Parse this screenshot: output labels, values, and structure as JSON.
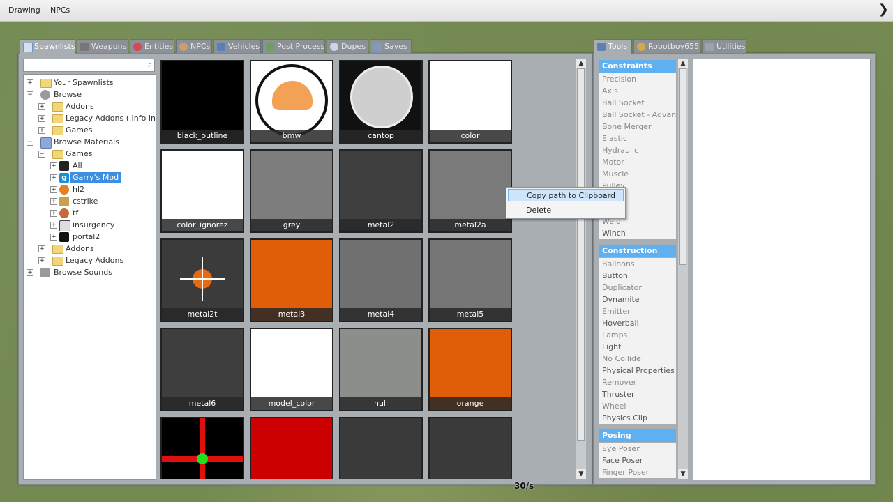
{
  "topbar": {
    "menu": [
      "Drawing",
      "NPCs"
    ]
  },
  "spawnmenu": {
    "tabs": [
      "Spawnlists",
      "Weapons",
      "Entities",
      "NPCs",
      "Vehicles",
      "Post Process",
      "Dupes",
      "Saves"
    ],
    "active_tab": "Spawnlists",
    "search": {
      "value": "",
      "placeholder": ""
    },
    "tree": [
      {
        "label": "Your Spawnlists",
        "expander": "+"
      },
      {
        "label": "Browse",
        "expander": "−"
      },
      {
        "label": "Addons",
        "expander": "+"
      },
      {
        "label": "Legacy Addons ( Info In...",
        "expander": "+"
      },
      {
        "label": "Games",
        "expander": "+"
      },
      {
        "label": "Browse Materials",
        "expander": "−"
      },
      {
        "label": "Games",
        "expander": "−"
      },
      {
        "label": "All",
        "expander": "+"
      },
      {
        "label": "Garry's Mod",
        "expander": "+",
        "selected": true
      },
      {
        "label": "hl2",
        "expander": "+"
      },
      {
        "label": "cstrike",
        "expander": "+"
      },
      {
        "label": "tf",
        "expander": "+"
      },
      {
        "label": "insurgency",
        "expander": "+"
      },
      {
        "label": "portal2",
        "expander": "+"
      },
      {
        "label": "Addons",
        "expander": "+"
      },
      {
        "label": "Legacy Addons",
        "expander": "+"
      },
      {
        "label": "Browse Sounds",
        "expander": "+"
      }
    ],
    "materials": [
      {
        "name": "black_outline",
        "color": "#000000"
      },
      {
        "name": "bmw",
        "color": "#ffffff"
      },
      {
        "name": "cantop",
        "color": "#111111"
      },
      {
        "name": "color",
        "color": "#ffffff"
      },
      {
        "name": "color_ignorez",
        "color": "#ffffff"
      },
      {
        "name": "grey",
        "color": "#7d7d7d"
      },
      {
        "name": "metal2",
        "color": "#3f3f3f"
      },
      {
        "name": "metal2a",
        "color": "#7a7a7a"
      },
      {
        "name": "metal2t",
        "color": "#3b3b3b"
      },
      {
        "name": "metal3",
        "color": "#e05d0a"
      },
      {
        "name": "metal4",
        "color": "#707070"
      },
      {
        "name": "metal5",
        "color": "#767676"
      },
      {
        "name": "metal6",
        "color": "#3e3e3e"
      },
      {
        "name": "model_color",
        "color": "#ffffff"
      },
      {
        "name": "null",
        "color": "#8b8e8a"
      },
      {
        "name": "orange",
        "color": "#e05d0a"
      },
      {
        "name": "",
        "color": "#000000"
      },
      {
        "name": "",
        "color": "#cc0000"
      },
      {
        "name": "",
        "color": "#3a3a3a"
      },
      {
        "name": "",
        "color": "#3a3a3a"
      }
    ],
    "context_menu": [
      "Copy path to Clipboard",
      "Delete"
    ]
  },
  "toolmenu": {
    "tabs": [
      "Tools",
      "Robotboy655",
      "Utilities"
    ],
    "active_tab": "Tools",
    "categories": [
      {
        "title": "Constraints",
        "items": [
          "Precision",
          "Axis",
          "Ball Socket",
          "Ball Socket - Advan...",
          "Bone Merger",
          "Elastic",
          "Hydraulic",
          "Motor",
          "Muscle",
          "Pulley",
          "Rope",
          "Slider",
          "Weld",
          "Winch"
        ]
      },
      {
        "title": "Construction",
        "items": [
          "Balloons",
          "Button",
          "Duplicator",
          "Dynamite",
          "Emitter",
          "Hoverball",
          "Lamps",
          "Light",
          "No Collide",
          "Physical Properties",
          "Remover",
          "Thruster",
          "Wheel",
          "Physics Clip"
        ]
      },
      {
        "title": "Posing",
        "items": [
          "Eye Poser",
          "Face Poser",
          "Finger Poser"
        ]
      }
    ]
  },
  "hud": {
    "fps": "30/s"
  }
}
